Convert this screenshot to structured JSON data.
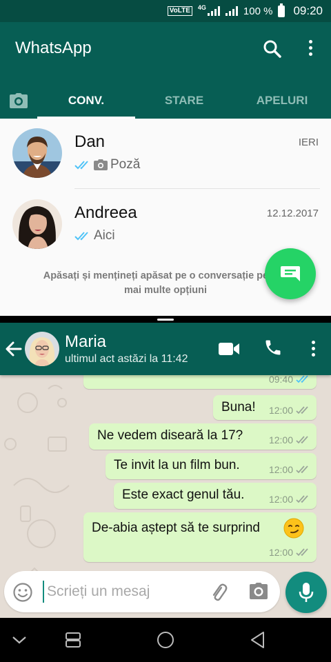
{
  "status_bar": {
    "volte": "VoLTE",
    "network": "4G",
    "battery": "100 %",
    "time": "09:20"
  },
  "app": {
    "title": "WhatsApp"
  },
  "tabs": [
    {
      "label": "CONV.",
      "active": true
    },
    {
      "label": "STARE",
      "active": false
    },
    {
      "label": "APELURI",
      "active": false
    }
  ],
  "chats": [
    {
      "name": "Dan",
      "time": "IERI",
      "preview": "Poză",
      "preview_icon": "camera-icon"
    },
    {
      "name": "Andreea",
      "time": "12.12.2017",
      "preview": "Aici"
    }
  ],
  "hint": {
    "line1": "Apăsați și mențineți apăsat pe o conversație pentru",
    "line2": "mai multe opțiuni"
  },
  "conversation": {
    "name": "Maria",
    "status": "ultimul act astăzi la 11:42",
    "messages": [
      {
        "text": "",
        "time": "09:40"
      },
      {
        "text": "Buna!",
        "time": "12:00"
      },
      {
        "text": "Ne vedem diseară la 17?",
        "time": "12:00"
      },
      {
        "text": "Te invit la un film bun.",
        "time": "12:00"
      },
      {
        "text": "Este exact genul tău.",
        "time": "12:00"
      },
      {
        "text": "De-abia aștept să te surprind",
        "time": "12:00",
        "emoji": "smirk-emoji-icon"
      }
    ]
  },
  "input": {
    "placeholder": "Scrieți un mesaj",
    "value": ""
  },
  "colors": {
    "header": "#075e54",
    "status_bar": "#064c42",
    "fab": "#25d366",
    "bubble": "#dcf8c6",
    "mic": "#128c7e",
    "chat_bg": "#e5ddd5",
    "tick": "#4fc3f7"
  }
}
